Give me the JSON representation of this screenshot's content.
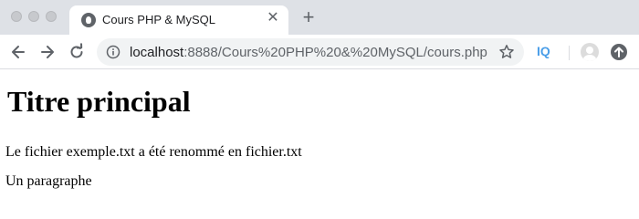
{
  "tab": {
    "title": "Cours PHP & MySQL",
    "favicon": "globe-icon",
    "close_glyph": "✕"
  },
  "tabstrip": {
    "new_tab_glyph": "+"
  },
  "address_bar": {
    "host": "localhost",
    "path": ":8888/Cours%20PHP%20&%20MySQL/cours.php"
  },
  "extensions": {
    "iq_label": "IQ"
  },
  "page": {
    "heading": "Titre principal",
    "paragraph_1": "Le fichier exemple.txt a été renommé en fichier.txt",
    "paragraph_2": "Un paragraphe"
  },
  "colors": {
    "tabstrip_bg": "#dee1e6",
    "omnibox_bg": "#f1f3f4",
    "iq_accent": "#4a9ee8"
  }
}
